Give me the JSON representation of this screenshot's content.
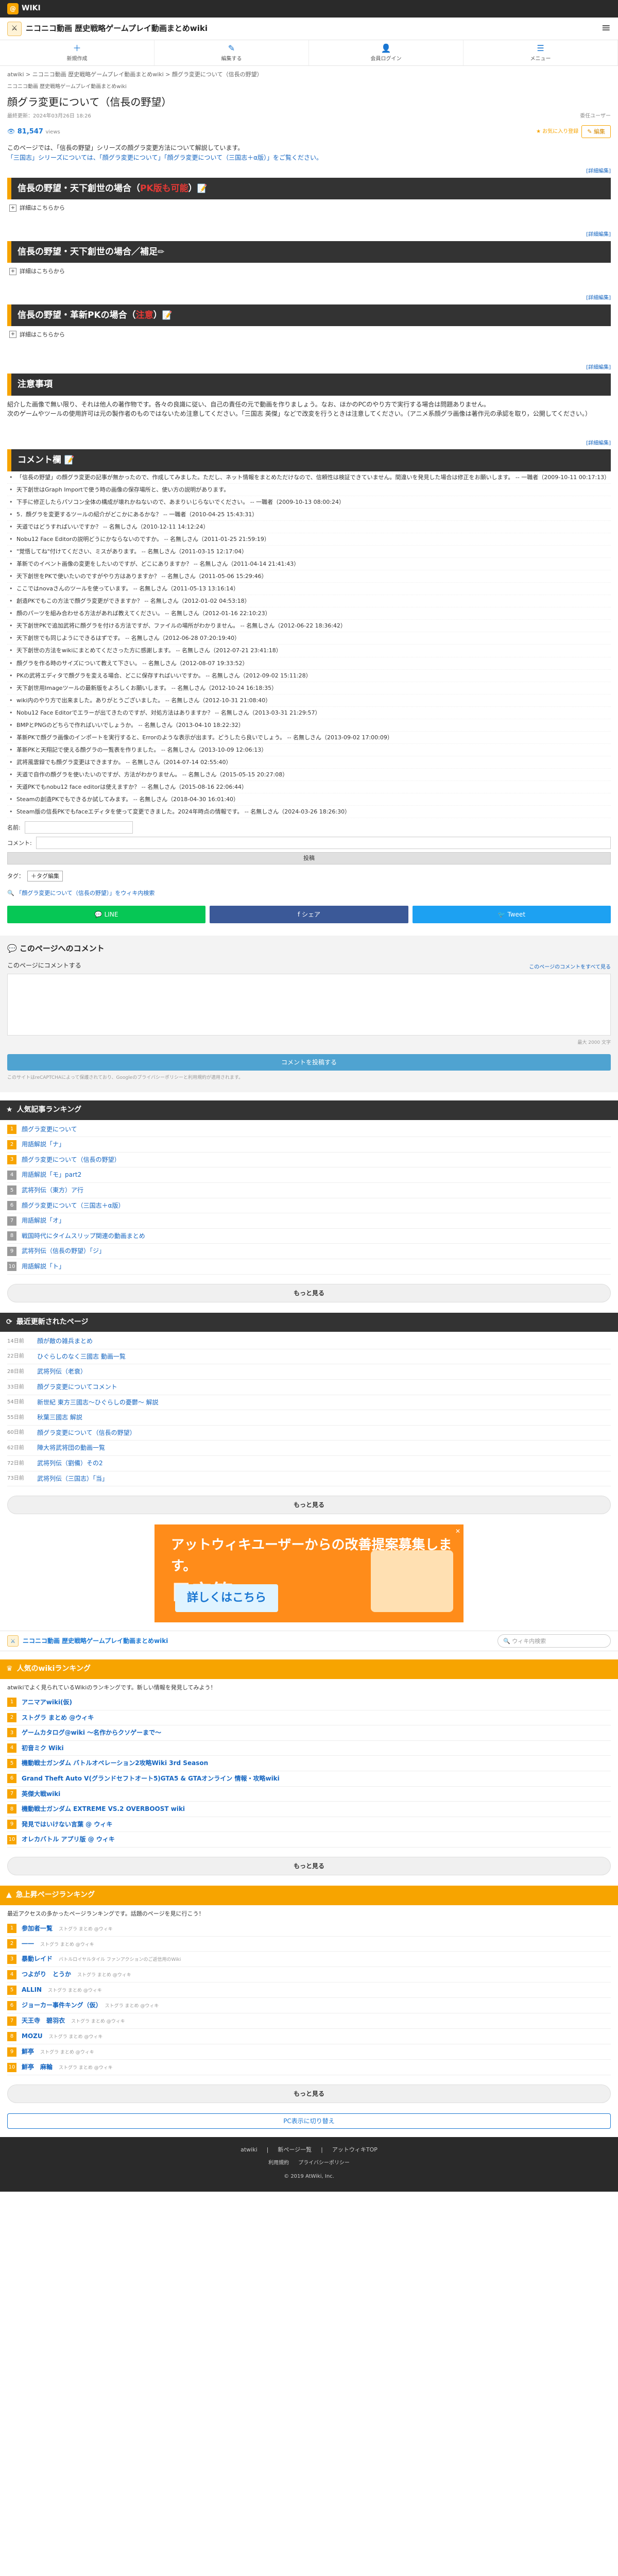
{
  "brand": {
    "logo_text": "WIKI"
  },
  "site": {
    "title": "ニコニコ動画 歴史戦略ゲームプレイ動画まとめwiki"
  },
  "nav": [
    {
      "label": "新規作成",
      "icon": "plus-icon"
    },
    {
      "label": "編集する",
      "icon": "pencil-icon"
    },
    {
      "label": "会員ログイン",
      "icon": "user-icon"
    },
    {
      "label": "メニュー",
      "icon": "menu-icon"
    }
  ],
  "breadcrumb": "atwiki > ニコニコ動画 歴史戦略ゲームプレイ動画まとめwiki > 顔グラ変更について（信長の野望）",
  "breadcrumb2": "ニコニコ動画 歴史戦略ゲームプレイ動画まとめwiki",
  "page": {
    "title": "顔グラ変更について（信長の野望）",
    "updated": "最終更新：2024年03月26日 18:26",
    "owner": "委任ユーザー",
    "pv": "81,547",
    "pv_unit": "views",
    "fav_label": "お気に入り登録",
    "edit_label": "編集",
    "intro1": "このページでは、「信長の野望」シリーズの顔グラ変更方法について解説しています。",
    "intro2": "「三国志」シリーズについては、「顔グラ変更について」「顔グラ変更について（三国志＋α版）」をご覧ください。",
    "edit_section": "[詳細編集]"
  },
  "sections": [
    {
      "title_a": "信長の野望・天下創世の場合（",
      "title_red": "PK版も可能",
      "title_b": "）",
      "emo": "📝",
      "fold": "詳細はこちらから"
    },
    {
      "title_a": "信長の野望・天下創世の場合／補足",
      "title_red": "",
      "title_b": "",
      "emo": "✏",
      "fold": "詳細はこちらから"
    },
    {
      "title_a": "信長の野望・革新PKの場合（",
      "title_red": "注意",
      "title_b": "）",
      "emo": "📝",
      "fold": "詳細はこちらから"
    }
  ],
  "notice": {
    "title": "注意事項",
    "text1": "紹介した画像で無い限り、それは他人の著作物です。各々の良識に従い、自己の責任の元で動画を作りましょう。なお、ほかのPCのやり方で実行する場合は問題ありません。",
    "text2": "次のゲームやツールの使用許可は元の製作者のものではないため注意してください。「三国志 英傑」などで改変を行うときは注意してください。（アニメ系顔グラ画像は著作元の承認を取り，公開してください。）"
  },
  "comments_section": {
    "title": "コメント欄",
    "items": [
      "「信長の野望」の顔グラ変更の記事が無かったので、作成してみました。ただし、ネット情報をまとめただけなので、信頼性は検証できていません。間違いを発見した場合は修正をお願いします。 -- 一職者（2009-10-11 00:17:13）",
      "天下創世はGraph Importで使う時の画像の保存場所と、使い方の説明があります。",
      "下手に修正したらパソコン全体の構成が壊れかねないので、あまりいじらないでください。 -- 一職者（2009-10-13 08:00:24）",
      "5．顔グラを変更するツールの紹介がどこかにあるかな？ -- 一職者（2010-04-25 15:43:31）",
      "天道ではどうすればいいですか？ -- 名無しさん（2010-12-11 14:12:24）",
      "Nobu12 Face Editorの説明どうにかならないのですか。 -- 名無しさん（2011-01-25 21:59:19）",
      "\"覚悟してね\"付けてください、ミスがあります。 -- 名無しさん（2011-03-15 12:17:04）",
      "革新でのイベント画像の変更をしたいのですが、どこにありますか？ -- 名無しさん（2011-04-14 21:41:43）",
      "天下創世をPKで使いたいのですがやり方はありますか？ -- 名無しさん（2011-05-06 15:29:46）",
      "ここではnovaさんのツールを使っています。 -- 名無しさん（2011-05-13 13:16:14）",
      "創造PKでもこの方法で顔グラ変更ができますか？ -- 名無しさん（2012-01-02 04:53:18）",
      "顔のパーツを組み合わせる方法があれば教えてください。 -- 名無しさん（2012-01-16 22:10:23）",
      "天下創世PKで追加武将に顔グラを付ける方法ですが、ファイルの場所がわかりません。 -- 名無しさん（2012-06-22 18:36:42）",
      "天下創世でも同じようにできるはずです。 -- 名無しさん（2012-06-28 07:20:19:40）",
      "天下創世の方法をwikiにまとめてくださった方に感謝します。 -- 名無しさん（2012-07-21 23:41:18）",
      "顔グラを作る時のサイズについて教えて下さい。 -- 名無しさん（2012-08-07 19:33:52）",
      "PKの武将エディタで顔グラを変える場合、どこに保存すればいいですか。 -- 名無しさん（2012-09-02 15:11:28）",
      "天下創世用Imageツールの最新版をよろしくお願いします。 -- 名無しさん（2012-10-24 16:18:35）",
      "wiki内のやり方で出来ました。ありがとうございました。 -- 名無しさん（2012-10-31 21:08:40）",
      "Nobu12 Face Editorでエラーが出てきたのですが、対処方法はありますか？ -- 名無しさん（2013-03-31 21:29:57）",
      "BMPとPNGのどちらで作ればいいでしょうか。 -- 名無しさん（2013-04-10 18:22:32）",
      "革新PKで顔グラ画像のインポートを実行すると、Errorのような表示が出ます。どうしたら良いでしょう。 -- 名無しさん（2013-09-02 17:00:09）",
      "革新PKと天翔記で使える顔グラの一覧表を作りました。 -- 名無しさん（2013-10-09 12:06:13）",
      "武将風雲録でも顔グラ変更はできますか。 -- 名無しさん（2014-07-14 02:55:40）",
      "天道で自作の顔グラを使いたいのですが、方法がわかりません。 -- 名無しさん（2015-05-15 20:27:08）",
      "天道PKでもnobu12 face editorは使えますか？ -- 名無しさん（2015-08-16 22:06:44）",
      "Steamの創造PKでもできるか試してみます。 -- 名無しさん（2018-04-30 16:01:40）",
      "Steam版の信長PKでもfaceエディタを使って変更できました。2024年時点の情報です。 -- 名無しさん（2024-03-26 18:26:30）"
    ],
    "name_label": "名前:",
    "comment_label": "コメント:",
    "post_label": "投稿"
  },
  "tags": {
    "label": "タグ：",
    "button": "＋タグ編集"
  },
  "related": "「顔グラ変更について（信長の野望）」をウィキ内検索",
  "share": [
    {
      "label": "LINE",
      "color": "#06c755"
    },
    {
      "label": "シェア",
      "color": "#3b5998"
    },
    {
      "label": "Tweet",
      "color": "#1da1f2"
    }
  ],
  "page_comment": {
    "header": "このページへのコメント",
    "heading": "このページにコメントする",
    "note_right": "このページのコメントをすべて見る",
    "textarea_note": "最大 2000 文字",
    "submit": "コメントを投稿する",
    "caption": "このサイトはreCAPTCHAによって保護されており、Googleのプライバシーポリシーと利用規約が適用されます。"
  },
  "popular": {
    "title": "人気記事ランキング",
    "items": [
      "顔グラ変更について",
      "用語解説「ナ」",
      "顔グラ変更について（信長の野望）",
      "用語解説「モ」part2",
      "武将列伝（東方）ア行",
      "顔グラ変更について（三国志＋α版）",
      "用語解説「オ」",
      "戦国時代にタイムスリップ関連の動画まとめ",
      "武将列伝（信長の野望）「ジ」",
      "用語解説「ト」"
    ],
    "more": "もっと見る"
  },
  "recent": {
    "title": "最近更新されたページ",
    "items": [
      {
        "date": "14日前",
        "name": "顔が敵の雑兵まとめ"
      },
      {
        "date": "22日前",
        "name": "ひぐらしのなく三國志 動画一覧"
      },
      {
        "date": "28日前",
        "name": "武将列伝（老衰）"
      },
      {
        "date": "33日前",
        "name": "顔グラ変更についてコメント"
      },
      {
        "date": "54日前",
        "name": "新世紀 東方三國志〜ひぐらしの憂鬱〜 解説"
      },
      {
        "date": "55日前",
        "name": "秋葉三國志 解説"
      },
      {
        "date": "60日前",
        "name": "顔グラ変更について（信長の野望）"
      },
      {
        "date": "62日前",
        "name": "陣大将武将団の動画一覧"
      },
      {
        "date": "72日前",
        "name": "武将列伝（劉備）その2"
      },
      {
        "date": "73日前",
        "name": "武将列伝（三国志）「当」"
      }
    ],
    "more": "もっと見る"
  },
  "ad": {
    "line1": "アットウィキユーザーからの改善提案募集します。",
    "line2": "目安箱",
    "button": "詳しくはこちら",
    "close": "✕"
  },
  "search": {
    "placeholder": "ウィキ内検索"
  },
  "atwiki_rank": {
    "title": "人気のwikiランキング",
    "desc": "atwikiでよく見られているWikiのランキングです。新しい情報を発見してみよう！",
    "items": [
      "アニマアwiki(仮)",
      "ストグラ まとめ @ウィキ",
      "ゲームカタログ@wiki 〜名作からクソゲーまで〜",
      "初音ミク Wiki",
      "機動戦士ガンダム バトルオペレーション2攻略Wiki 3rd Season",
      "Grand Theft Auto V(グランドセフトオート5)GTA5 & GTAオンライン 情報・攻略wiki",
      "英傑大戦wiki",
      "機動戦士ガンダム EXTREME VS.2 OVERBOOST wiki",
      "発見ではいけない言葉 @ ウィキ",
      "オレカバトル アプリ版 @ ウィキ"
    ],
    "more": "もっと見る"
  },
  "hot_pages": {
    "title": "急上昇ページランキング",
    "desc": "最近アクセスの多かったページランキングです。話題のページを見に行こう！",
    "items": [
      {
        "name": "参加者一覧",
        "sub": "ストグラ まとめ @ウィキ"
      },
      {
        "name": "一一",
        "sub": "ストグラ まとめ @ウィキ"
      },
      {
        "name": "暴動レイド",
        "sub": "バトルロイヤルタイル ファンアクションのご返信用のWiki"
      },
      {
        "name": "つよがり　とうか",
        "sub": "ストグラ まとめ @ウィキ"
      },
      {
        "name": "ALLIN",
        "sub": "ストグラ まとめ @ウィキ"
      },
      {
        "name": "ジョーカー事件キング（仮）",
        "sub": "ストグラ まとめ @ウィキ"
      },
      {
        "name": "天王寺　碧羽衣",
        "sub": "ストグラ まとめ @ウィキ"
      },
      {
        "name": "MOZU",
        "sub": "ストグラ まとめ @ウィキ"
      },
      {
        "name": "鮮亭",
        "sub": "ストグラ まとめ @ウィキ"
      },
      {
        "name": "鮮亭　麻輪",
        "sub": "ストグラ まとめ @ウィキ"
      }
    ],
    "more": "もっと見る"
  },
  "pc_site": "PC表示に切り替え",
  "footer": {
    "links1": [
      "atwiki",
      "新ページ一覧",
      "アットウィキTOP"
    ],
    "links2": [
      "利用規約",
      "プライバシーポリシー"
    ],
    "copyright": "2019 AtWiki, Inc."
  }
}
